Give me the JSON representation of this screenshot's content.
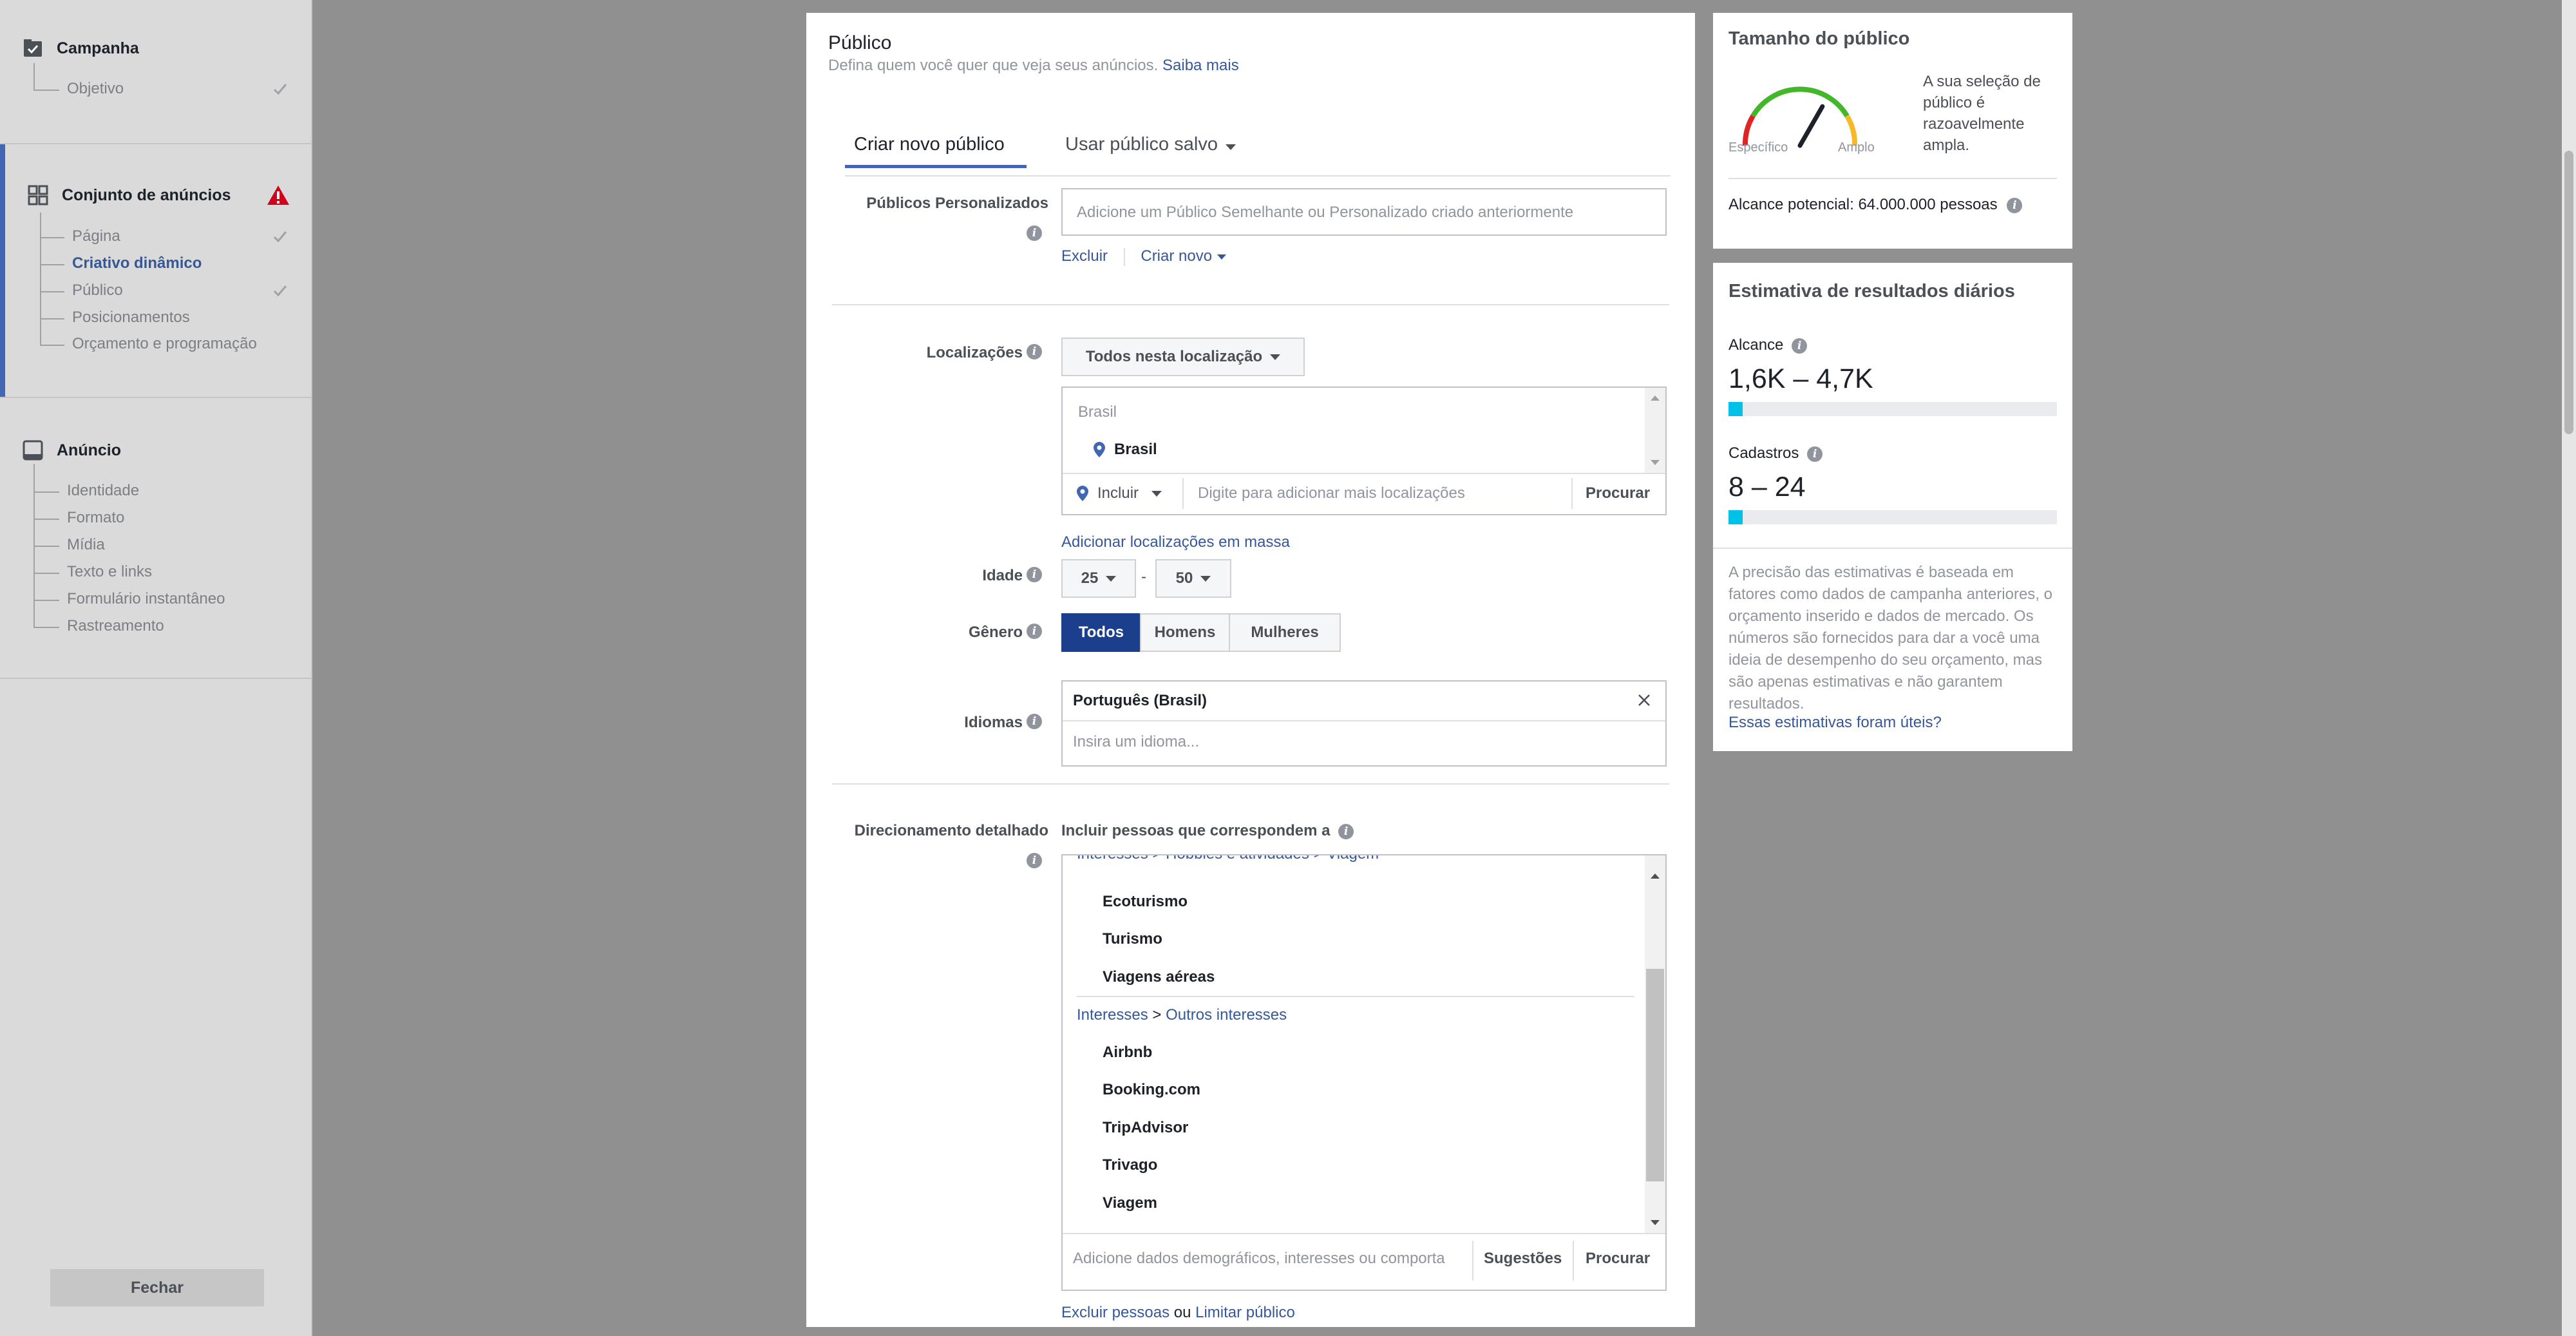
{
  "sidebar": {
    "campaign": {
      "label": "Campanha",
      "items": [
        {
          "label": "Objetivo",
          "done": true
        }
      ]
    },
    "adset": {
      "label": "Conjunto de anúncios",
      "items": [
        {
          "label": "Página",
          "done": true
        },
        {
          "label": "Criativo dinâmico",
          "active": true
        },
        {
          "label": "Público",
          "done": true
        },
        {
          "label": "Posicionamentos"
        },
        {
          "label": "Orçamento e programação"
        }
      ]
    },
    "ad": {
      "label": "Anúncio",
      "items": [
        {
          "label": "Identidade"
        },
        {
          "label": "Formato"
        },
        {
          "label": "Mídia"
        },
        {
          "label": "Texto e links"
        },
        {
          "label": "Formulário instantâneo"
        },
        {
          "label": "Rastreamento"
        }
      ]
    },
    "close_label": "Fechar"
  },
  "audience": {
    "title": "Público",
    "subtitle": "Defina quem você quer que veja seus anúncios.",
    "learn_more": "Saiba mais",
    "tabs": {
      "new": "Criar novo público",
      "saved": "Usar público salvo"
    },
    "custom": {
      "label": "Públicos Personalizados",
      "placeholder": "Adicione um Público Semelhante ou Personalizado criado anteriormente",
      "exclude": "Excluir",
      "create_new": "Criar novo"
    },
    "locations": {
      "label": "Localizações",
      "dropdown": "Todos nesta localização",
      "group": "Brasil",
      "selected": "Brasil",
      "include": "Incluir",
      "input_placeholder": "Digite para adicionar mais localizações",
      "search": "Procurar",
      "bulk": "Adicionar localizações em massa"
    },
    "age": {
      "label": "Idade",
      "min": "25",
      "sep": "-",
      "max": "50"
    },
    "gender": {
      "label": "Gênero",
      "options": [
        "Todos",
        "Homens",
        "Mulheres"
      ],
      "selected": "Todos"
    },
    "languages": {
      "label": "Idiomas",
      "selected": "Português (Brasil)",
      "placeholder": "Insira um idioma..."
    },
    "detailed": {
      "label": "Direcionamento detalhado",
      "include_text": "Incluir pessoas que correspondem a",
      "cut_path": "Interesses > Hobbies e atividades > Viagem",
      "group1_items": [
        "Ecoturismo",
        "Turismo",
        "Viagens aéreas"
      ],
      "group2_path_a": "Interesses",
      "group2_path_sep": ">",
      "group2_path_b": "Outros interesses",
      "group2_items": [
        "Airbnb",
        "Booking.com",
        "TripAdvisor",
        "Trivago",
        "Viagem"
      ],
      "input_placeholder": "Adicione dados demográficos, interesses ou comporta",
      "suggestions": "Sugestões",
      "search": "Procurar",
      "exclude_people": "Excluir pessoas",
      "or": "ou",
      "narrow": "Limitar público"
    }
  },
  "audience_size": {
    "title": "Tamanho do público",
    "gauge_specific": "Específico",
    "gauge_broad": "Amplo",
    "gauge_level": 0.62,
    "description": "A sua seleção de público é razoavelmente ampla.",
    "potential_reach": "Alcance potencial: 64.000.000 pessoas"
  },
  "daily_results": {
    "title": "Estimativa de resultados diários",
    "reach_label": "Alcance",
    "reach_value": "1,6K – 4,7K",
    "reach_fill": 0.04,
    "leads_label": "Cadastros",
    "leads_value": "8 – 24",
    "leads_fill": 0.04,
    "note": "A precisão das estimativas é baseada em fatores como dados de campanha anteriores, o orçamento inserido e dados de mercado. Os números são fornecidos para dar a você uma ideia de desempenho do seu orçamento, mas são apenas estimativas e não garantem resultados.",
    "feedback_link": "Essas estimativas foram úteis?"
  },
  "colors": {
    "accent": "#4267b2",
    "link": "#365899",
    "selected_gender": "#1b3f8c",
    "estimate_bar": "#00c2e8",
    "warning": "#d0021b"
  }
}
